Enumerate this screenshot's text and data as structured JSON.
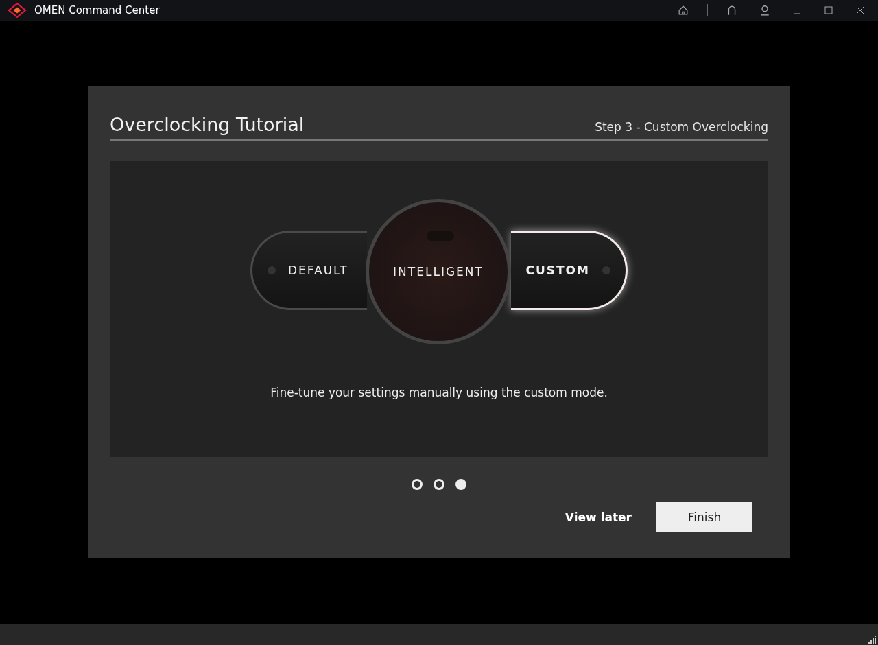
{
  "window": {
    "title": "OMEN Command Center"
  },
  "tutorial": {
    "title": "Overclocking Tutorial",
    "step": "Step 3 - Custom Overclocking",
    "description": "Fine-tune your settings manually using the custom mode."
  },
  "modes": [
    {
      "kind": "left",
      "label": "DEFAULT",
      "selected": false
    },
    {
      "kind": "center",
      "label": "INTELLIGENT",
      "selected": false
    },
    {
      "kind": "right",
      "label": "CUSTOM",
      "selected": true
    }
  ],
  "pager": [
    {
      "selected": false
    },
    {
      "selected": false
    },
    {
      "selected": true
    }
  ],
  "buttons": {
    "secondary": "View later",
    "primary": "Finish"
  }
}
